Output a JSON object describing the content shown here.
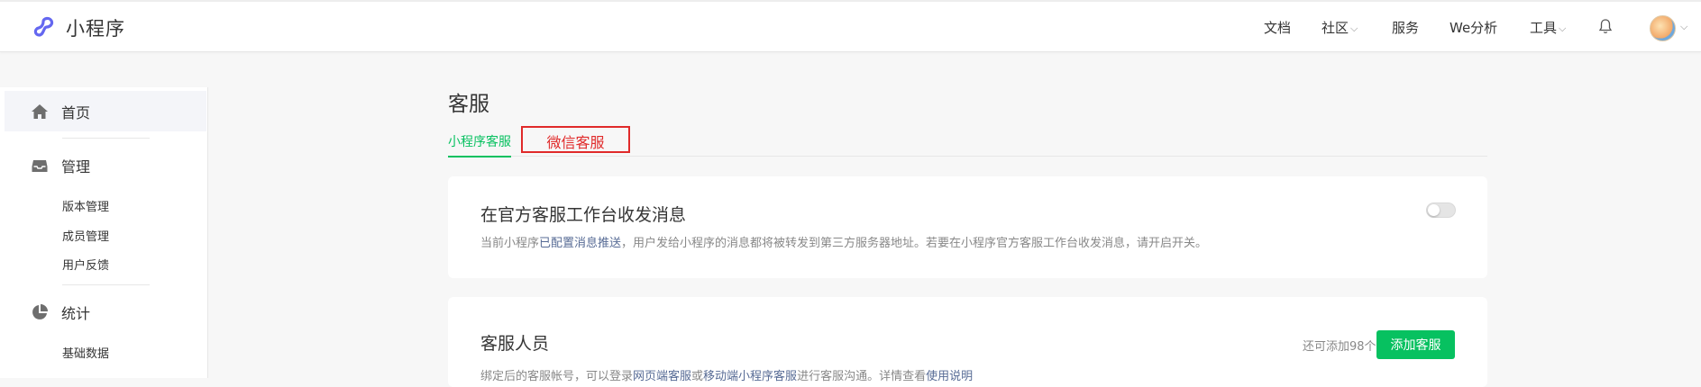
{
  "app": {
    "logo_text": "小程序"
  },
  "topnav": {
    "docs": "文档",
    "community": "社区",
    "service": "服务",
    "we_analysis": "We分析",
    "tools": "工具"
  },
  "sidebar": {
    "home": "首页",
    "manage": "管理",
    "manage_items": [
      "版本管理",
      "成员管理",
      "用户反馈"
    ],
    "stats": "统计",
    "stats_items": [
      "基础数据"
    ]
  },
  "page": {
    "title": "客服",
    "tabs": [
      "小程序客服",
      "微信客服"
    ]
  },
  "card1": {
    "title": "在官方客服工作台收发消息",
    "desc_pre": "当前小程序",
    "desc_link": "已配置消息推送",
    "desc_post": "，用户发给小程序的消息都将被转发到第三方服务器地址。若要在小程序官方客服工作台收发消息，请开启开关。",
    "toggle_on": false
  },
  "card2": {
    "title": "客服人员",
    "quota": "还可添加98个",
    "add_button": "添加客服",
    "desc_pre": "绑定后的客服帐号，可以登录",
    "desc_link1": "网页端客服",
    "desc_mid1": "或",
    "desc_link2": "移动端小程序客服",
    "desc_mid2": "进行客服沟通。详情查看",
    "desc_link3": "使用说明"
  },
  "colors": {
    "accent": "#07c160",
    "link": "#576b95",
    "highlight": "#e02a2a"
  }
}
